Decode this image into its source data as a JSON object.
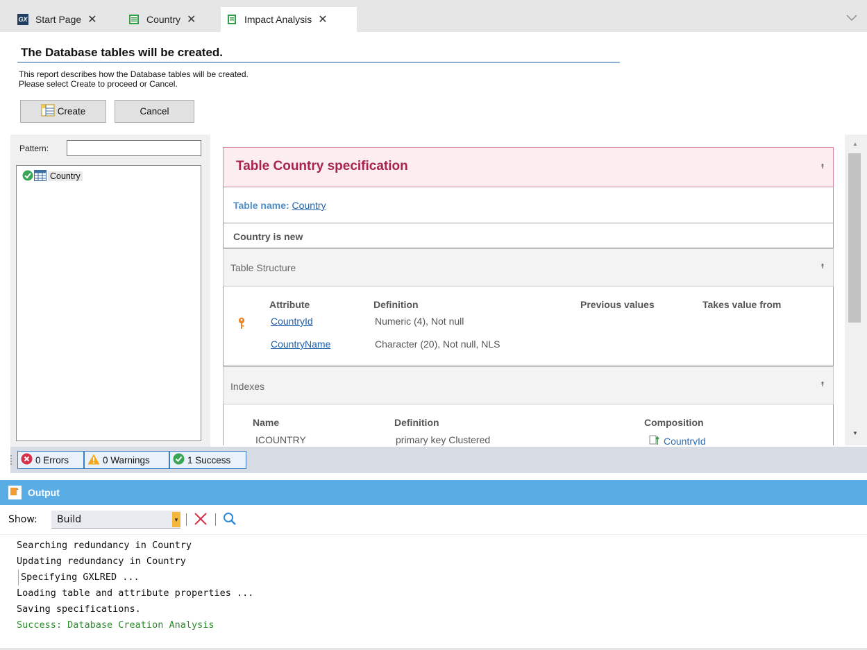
{
  "tabs": [
    {
      "label": "Start Page",
      "icon": "gx-logo-icon",
      "active": false
    },
    {
      "label": "Country",
      "icon": "transaction-icon",
      "active": false
    },
    {
      "label": "Impact Analysis",
      "icon": "report-icon",
      "active": true
    }
  ],
  "header": {
    "title": "The Database tables will be created.",
    "description_line1": "This report describes how the Database tables will be created.",
    "description_line2": "Please select Create to proceed or Cancel.",
    "create_label": "Create",
    "cancel_label": "Cancel"
  },
  "left_pane": {
    "pattern_label": "Pattern:",
    "pattern_value": "",
    "tree_items": [
      {
        "label": "Country",
        "status": "success"
      }
    ]
  },
  "report": {
    "spec_title": "Table Country specification",
    "table_name_label": "Table name:",
    "table_name_value": "Country",
    "status_text": "Country is new",
    "structure": {
      "heading": "Table Structure",
      "columns": [
        "Attribute",
        "Definition",
        "Previous values",
        "Takes value from"
      ],
      "rows": [
        {
          "attribute": "CountryId",
          "definition": "Numeric (4), Not null",
          "key": true
        },
        {
          "attribute": "CountryName",
          "definition": "Character (20), Not null, NLS",
          "key": false
        }
      ]
    },
    "indexes": {
      "heading": "Indexes",
      "columns": [
        "Name",
        "Definition",
        "Composition"
      ],
      "rows": [
        {
          "name": "ICOUNTRY",
          "definition": "primary key Clustered",
          "composition": "CountryId"
        }
      ]
    }
  },
  "statusbar": {
    "errors": "0 Errors",
    "warnings": "0 Warnings",
    "success": "1 Success"
  },
  "output": {
    "title": "Output",
    "show_label": "Show:",
    "show_value": "Build",
    "lines": [
      "Searching redundancy in Country",
      "Updating redundancy in Country",
      "Specifying GXLRED ...",
      "Loading table and attribute properties ...",
      "Saving specifications.",
      "Success: Database Creation Analysis"
    ]
  },
  "colors": {
    "spec_title": "#a8244e",
    "link": "#1f5fa8",
    "output_header": "#5aace4",
    "success_text": "#2b8a2b"
  }
}
